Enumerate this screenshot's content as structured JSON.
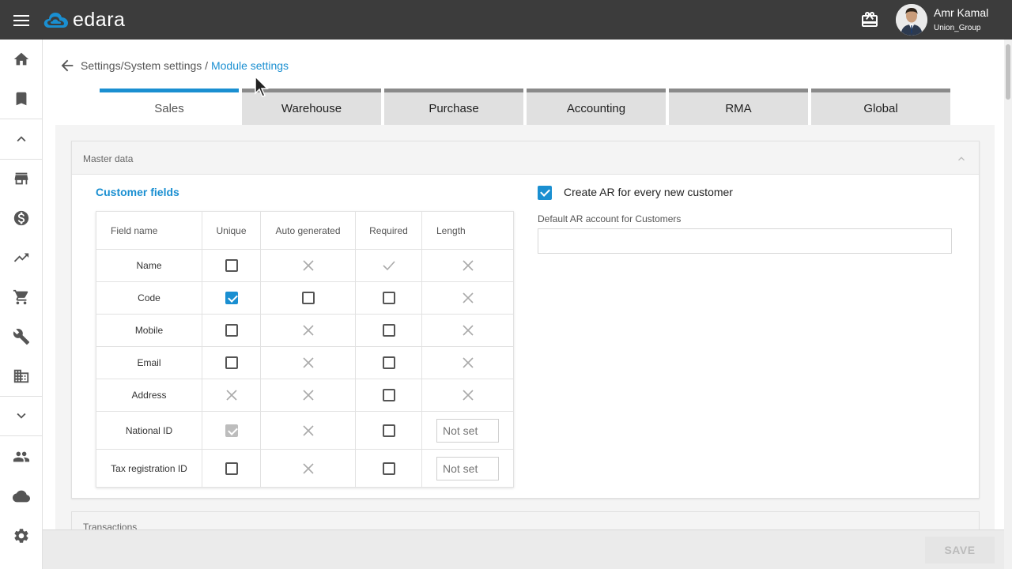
{
  "header": {
    "logo_text": "edara",
    "user_name": "Amr Kamal",
    "user_org": "Union_Group"
  },
  "sidebar": {
    "items": [
      "home-icon",
      "bookmark-icon",
      "chevron-up-icon",
      "store-icon",
      "dollar-icon",
      "trending-icon",
      "cart-icon",
      "wrench-icon",
      "building-icon",
      "chevron-down-icon",
      "people-icon",
      "cloud-icon",
      "gear-icon"
    ]
  },
  "breadcrumb": {
    "path": "Settings/System settings / ",
    "current": "Module settings"
  },
  "tabs": [
    {
      "label": "Sales",
      "active": true
    },
    {
      "label": "Warehouse",
      "active": false
    },
    {
      "label": "Purchase",
      "active": false
    },
    {
      "label": "Accounting",
      "active": false
    },
    {
      "label": "RMA",
      "active": false
    },
    {
      "label": "Global",
      "active": false
    }
  ],
  "master_data": {
    "title": "Master data",
    "section_title": "Customer fields",
    "columns": [
      "Field name",
      "Unique",
      "Auto generated",
      "Required",
      "Length"
    ],
    "rows": [
      {
        "name": "Name",
        "unique": "unchecked",
        "auto": "x",
        "required": "tick",
        "length": "x"
      },
      {
        "name": "Code",
        "unique": "checked",
        "auto": "unchecked",
        "required": "unchecked",
        "length": "x"
      },
      {
        "name": "Mobile",
        "unique": "unchecked",
        "auto": "x",
        "required": "unchecked",
        "length": "x"
      },
      {
        "name": "Email",
        "unique": "unchecked",
        "auto": "x",
        "required": "unchecked",
        "length": "x"
      },
      {
        "name": "Address",
        "unique": "x",
        "auto": "x",
        "required": "unchecked",
        "length": "x"
      },
      {
        "name": "National ID",
        "unique": "disabled",
        "auto": "x",
        "required": "unchecked",
        "length": "input"
      },
      {
        "name": "Tax registration ID",
        "unique": "unchecked",
        "auto": "x",
        "required": "unchecked",
        "length": "input"
      }
    ],
    "length_placeholder": "Not set",
    "create_ar_label": "Create AR for every new customer",
    "create_ar_checked": true,
    "default_ar_label": "Default AR account for Customers",
    "default_ar_value": ""
  },
  "transactions": {
    "title": "Transactions"
  },
  "footer": {
    "save_label": "SAVE"
  },
  "colors": {
    "accent": "#1a8fd1",
    "topbar": "#3c3c3c"
  }
}
